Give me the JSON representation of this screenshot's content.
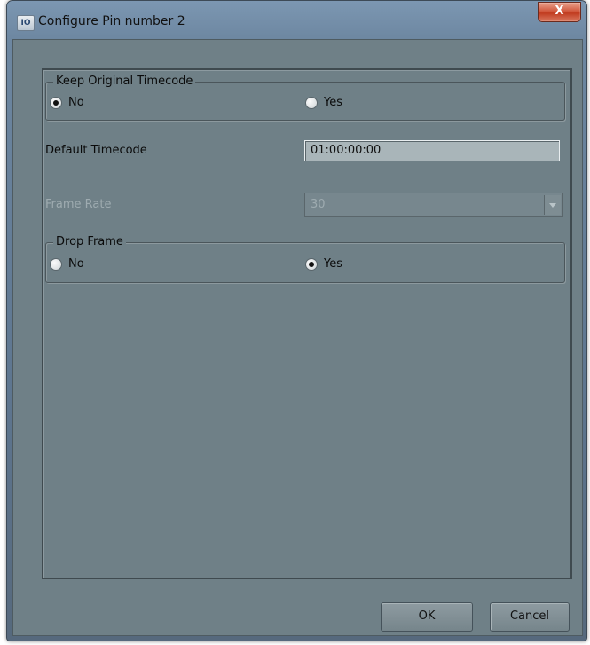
{
  "window": {
    "title": "Configure Pin number 2",
    "icon_text": "IO",
    "close_label": "X"
  },
  "keep_original_timecode": {
    "label": "Keep Original Timecode",
    "options": [
      {
        "label": "No",
        "checked": true
      },
      {
        "label": "Yes",
        "checked": false
      }
    ]
  },
  "default_timecode": {
    "label": "Default Timecode",
    "value": "01:00:00:00"
  },
  "frame_rate": {
    "label": "Frame Rate",
    "value": "30",
    "disabled": true
  },
  "drop_frame": {
    "label": "Drop Frame",
    "options": [
      {
        "label": "No",
        "checked": false
      },
      {
        "label": "Yes",
        "checked": true
      }
    ]
  },
  "buttons": {
    "ok": "OK",
    "cancel": "Cancel"
  },
  "colors": {
    "client_bg": "#6f8087",
    "titlebar": "#6d87a1",
    "close_red": "#c13b1f"
  },
  "icons": [
    "app-icon",
    "close-icon",
    "chevron-down-icon"
  ]
}
